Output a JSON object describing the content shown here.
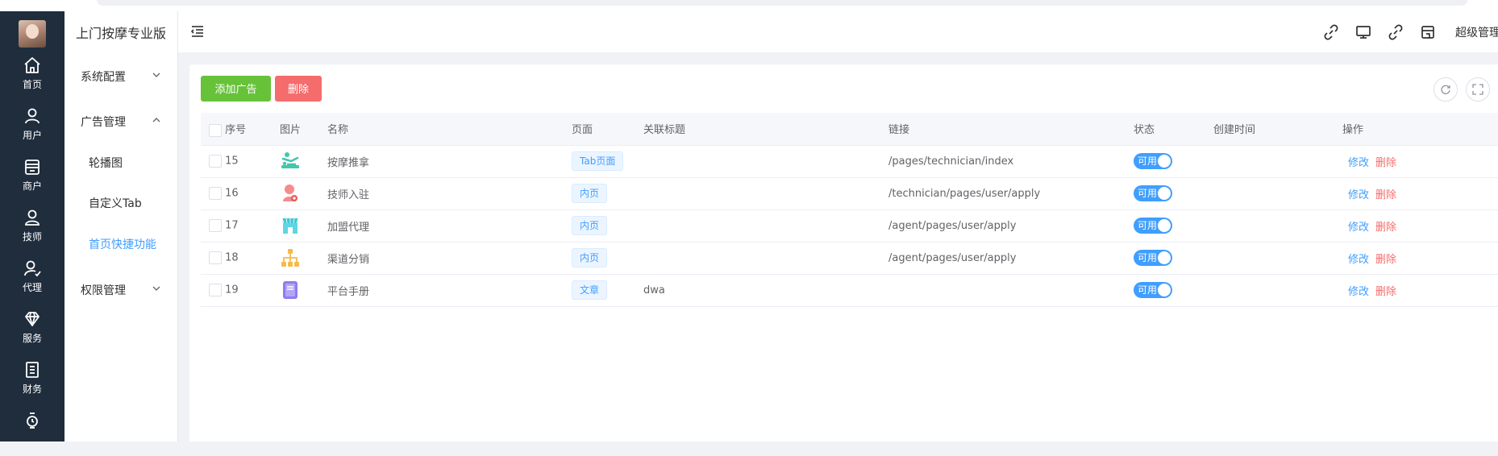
{
  "app_title": "上门按摩专业版",
  "rail": [
    {
      "label": "首页",
      "icon": "home-icon"
    },
    {
      "label": "用户",
      "icon": "user-icon"
    },
    {
      "label": "商户",
      "icon": "shop-icon"
    },
    {
      "label": "技师",
      "icon": "technician-icon"
    },
    {
      "label": "代理",
      "icon": "agent-icon"
    },
    {
      "label": "服务",
      "icon": "diamond-icon"
    },
    {
      "label": "财务",
      "icon": "finance-icon"
    },
    {
      "label": "",
      "icon": "watch-icon"
    }
  ],
  "subnav": {
    "groups": [
      {
        "label": "系统配置",
        "expanded": false
      },
      {
        "label": "广告管理",
        "expanded": true
      },
      {
        "label": "权限管理",
        "expanded": false
      }
    ],
    "items": [
      {
        "label": "轮播图",
        "active": false
      },
      {
        "label": "自定义Tab",
        "active": false
      },
      {
        "label": "首页快捷功能",
        "active": true
      }
    ]
  },
  "header": {
    "user": "超级管理",
    "icons": [
      "link-icon",
      "monitor-icon",
      "link-icon",
      "store-icon"
    ]
  },
  "toolbar": {
    "add_label": "添加广告",
    "delete_label": "删除"
  },
  "table": {
    "headers": [
      "序号",
      "图片",
      "名称",
      "页面",
      "关联标题",
      "链接",
      "状态",
      "创建时间",
      "操作"
    ],
    "rows": [
      {
        "id": "15",
        "icon": "massage-icon",
        "name": "按摩推拿",
        "page": "Tab页面",
        "title": "",
        "link": "/pages/technician/index",
        "status": "可用",
        "created": ""
      },
      {
        "id": "16",
        "icon": "technician-join-icon",
        "name": "技师入驻",
        "page": "内页",
        "title": "",
        "link": "/technician/pages/user/apply",
        "status": "可用",
        "created": ""
      },
      {
        "id": "17",
        "icon": "franchise-store-icon",
        "name": "加盟代理",
        "page": "内页",
        "title": "",
        "link": "/agent/pages/user/apply",
        "status": "可用",
        "created": ""
      },
      {
        "id": "18",
        "icon": "channel-tree-icon",
        "name": "渠道分销",
        "page": "内页",
        "title": "",
        "link": "/agent/pages/user/apply",
        "status": "可用",
        "created": ""
      },
      {
        "id": "19",
        "icon": "manual-book-icon",
        "name": "平台手册",
        "page": "文章",
        "title": "dwa",
        "link": "",
        "status": "可用",
        "created": ""
      }
    ],
    "edit_label": "修改",
    "delete_label": "删除"
  },
  "colors": {
    "rail_bg": "#1f2d3d",
    "primary": "#409eff",
    "success": "#67c23a",
    "danger": "#f56c6c"
  }
}
